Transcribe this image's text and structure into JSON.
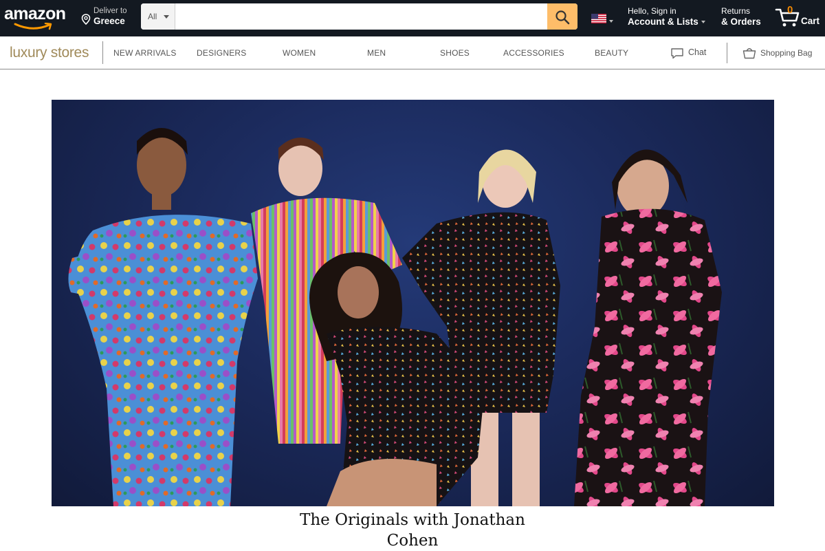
{
  "header": {
    "logo_text": "amazon",
    "deliver_label": "Deliver to",
    "deliver_location": "Greece",
    "search": {
      "category": "All",
      "value": "",
      "placeholder": ""
    },
    "account_greeting": "Hello, Sign in",
    "account_label": "Account & Lists",
    "returns_label": "Returns",
    "orders_label": "& Orders",
    "cart_count": "0",
    "cart_label": "Cart",
    "colors": {
      "bar": "#131921",
      "search_button": "#febd69",
      "cart_count": "#f08804"
    }
  },
  "luxury_nav": {
    "logo_text": "luxury stores",
    "items": [
      "NEW ARRIVALS",
      "DESIGNERS",
      "WOMEN",
      "MEN",
      "SHOES",
      "ACCESSORIES",
      "BEAUTY"
    ],
    "chat_label": "Chat",
    "bag_label": "Shopping Bag",
    "logo_color": "#a08a5a"
  },
  "hero": {
    "image_description_icons": [
      "model-figure-icon"
    ],
    "title": "The Originals with Jonathan Cohen"
  }
}
